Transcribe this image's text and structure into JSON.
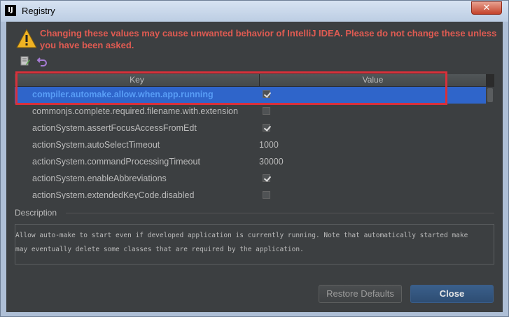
{
  "window": {
    "title": "Registry",
    "app_icon": "IJ",
    "close_symbol": "✕"
  },
  "warning": {
    "icon": "warning-triangle-icon",
    "text": "Changing these values may cause unwanted behavior of IntelliJ IDEA. Please do not change these unless you have been asked."
  },
  "toolbar": {
    "icons": [
      "edit-icon",
      "undo-icon"
    ]
  },
  "table": {
    "columns": [
      "Key",
      "Value"
    ],
    "rows": [
      {
        "key": "compiler.automake.allow.when.app.running",
        "type": "checkbox",
        "checked": true,
        "selected": true
      },
      {
        "key": "commonjs.complete.required.filename.with.extension",
        "type": "checkbox",
        "checked": false
      },
      {
        "key": "actionSystem.assertFocusAccessFromEdt",
        "type": "checkbox",
        "checked": true
      },
      {
        "key": "actionSystem.autoSelectTimeout",
        "type": "text",
        "value": "1000"
      },
      {
        "key": "actionSystem.commandProcessingTimeout",
        "type": "text",
        "value": "30000"
      },
      {
        "key": "actionSystem.enableAbbreviations",
        "type": "checkbox",
        "checked": true
      },
      {
        "key": "actionSystem.extendedKeyCode.disabled",
        "type": "checkbox",
        "checked": false
      }
    ]
  },
  "description": {
    "title": "Description",
    "text": "Allow auto-make to start even if developed application is currently running. Note that automatically started make\nmay eventually delete some classes that are required by the application."
  },
  "buttons": {
    "restore_defaults": "Restore Defaults",
    "close": "Close"
  },
  "colors": {
    "accent": "#2f65ca",
    "warning_text": "#e05b52",
    "highlight_box": "#d8303a"
  }
}
